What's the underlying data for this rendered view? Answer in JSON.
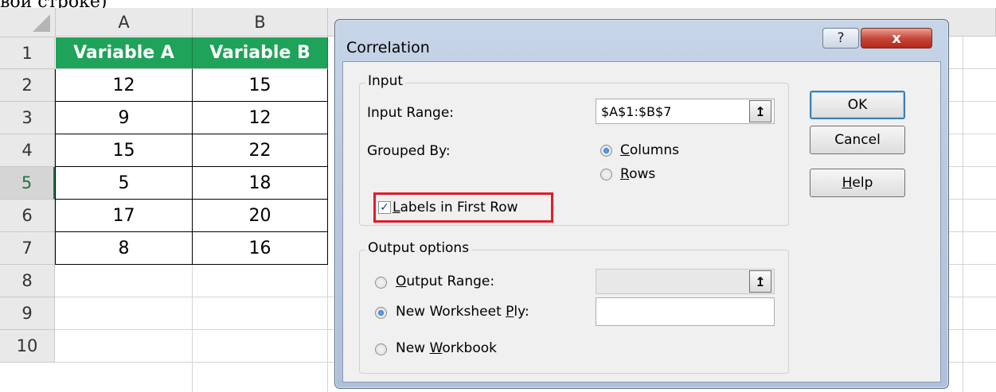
{
  "top_text": "вой строке)",
  "sheet": {
    "columns": [
      "A",
      "B"
    ],
    "rows": [
      "1",
      "2",
      "3",
      "4",
      "5",
      "6",
      "7",
      "8",
      "9",
      "10"
    ],
    "headers": [
      "Variable A",
      "Variable B"
    ],
    "data": [
      [
        "12",
        "15"
      ],
      [
        "9",
        "12"
      ],
      [
        "15",
        "22"
      ],
      [
        "5",
        "18"
      ],
      [
        "17",
        "20"
      ],
      [
        "8",
        "16"
      ]
    ],
    "selected_row": "5",
    "header_color": "#1fa35a"
  },
  "dialog": {
    "title": "Correlation",
    "help_glyph": "?",
    "close_glyph": "x",
    "input_group": "Input",
    "input_range_label": "Input Range:",
    "input_range_value": "$A$1:$B$7",
    "grouped_by_label": "Grouped By:",
    "columns_pre": "",
    "columns_u": "C",
    "columns_post": "olumns",
    "rows_pre": "",
    "rows_u": "R",
    "rows_post": "ows",
    "labels_pre": "",
    "labels_u": "L",
    "labels_post": "abels in First Row",
    "labels_checked": "✓",
    "output_group": "Output options",
    "output_range_pre": "",
    "output_range_u": "O",
    "output_range_post": "utput Range:",
    "new_ply_pre": "New Worksheet ",
    "new_ply_u": "P",
    "new_ply_post": "ly:",
    "new_wb_pre": "New ",
    "new_wb_u": "W",
    "new_wb_post": "orkbook",
    "ok": "OK",
    "cancel": "Cancel",
    "help_pre": "",
    "help_u": "H",
    "help_post": "elp",
    "ref_glyph": "↥",
    "highlight_color": "#e01b2a"
  }
}
